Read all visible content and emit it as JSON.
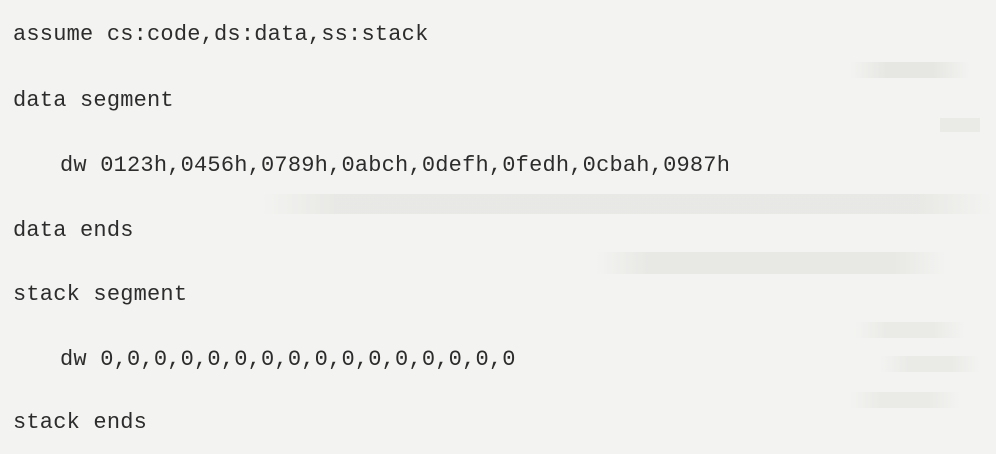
{
  "code_lines": [
    "assume cs:code,ds:data,ss:stack",
    "data segment",
    "dw 0123h,0456h,0789h,0abch,0defh,0fedh,0cbah,0987h",
    "data ends",
    "stack segment",
    "dw 0,0,0,0,0,0,0,0,0,0,0,0,0,0,0,0",
    "stack ends"
  ]
}
